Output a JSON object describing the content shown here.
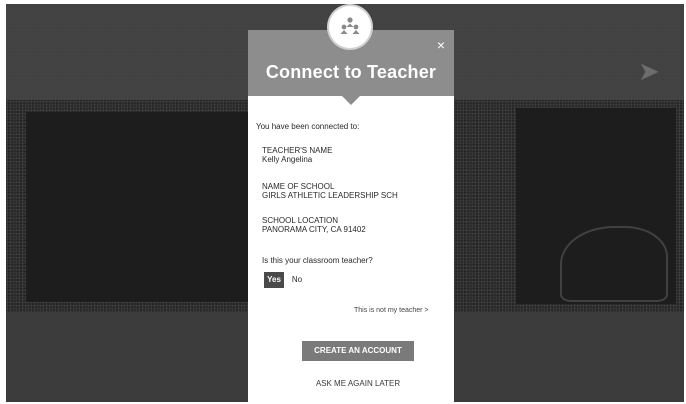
{
  "background": {
    "hero_heading": "",
    "panel_left_kicker": "",
    "panel_left_title": "",
    "panel_right_kicker": "",
    "panel_right_title": ""
  },
  "modal": {
    "title": "Connect to Teacher",
    "close_symbol": "×",
    "intro": "You have been connected to:",
    "fields": [
      {
        "label": "TEACHER'S NAME",
        "value": "Kelly Angelina"
      },
      {
        "label": "NAME OF SCHOOL",
        "value": "GIRLS ATHLETIC LEADERSHIP SCH"
      },
      {
        "label": "SCHOOL LOCATION",
        "value": "PANORAMA CITY, CA 91402"
      }
    ],
    "question": "Is this your classroom teacher?",
    "yes_label": "Yes",
    "no_label": "No",
    "not_teacher_link": "This is not my teacher >",
    "create_account_label": "CREATE AN ACCOUNT",
    "ask_later_label": "ASK ME AGAIN LATER"
  },
  "icons": {
    "logo": "group-people-icon",
    "close": "close-icon",
    "background_arrow": "arrow-icon"
  },
  "colors": {
    "header": "#8d8d8d",
    "backdrop": "#2b2b2b",
    "primary_button": "#7a7a7a",
    "yes_button": "#4a4a4a"
  }
}
